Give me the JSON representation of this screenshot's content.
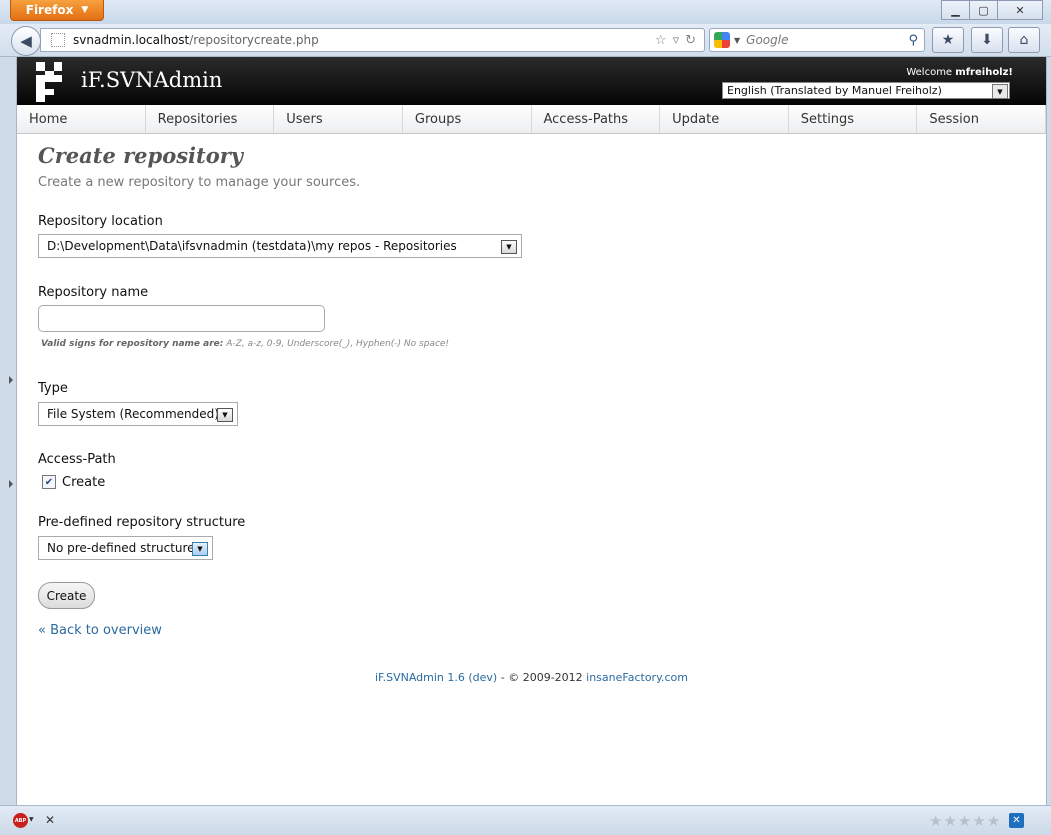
{
  "browser": {
    "menu_button": "Firefox",
    "url_host": "svnadmin.localhost",
    "url_path": "/repositorycreate.php",
    "search_placeholder": "Google"
  },
  "app": {
    "title": "iF.SVNAdmin",
    "welcome_prefix": "Welcome",
    "username": "mfreiholz!",
    "language": "English (Translated by Manuel Freiholz)"
  },
  "nav": {
    "items": [
      "Home",
      "Repositories",
      "Users",
      "Groups",
      "Access-Paths",
      "Update",
      "Settings",
      "Session"
    ]
  },
  "page": {
    "title": "Create repository",
    "subtitle": "Create a new repository to manage your sources.",
    "location_label": "Repository location",
    "location_value": "D:\\Development\\Data\\ifsvnadmin (testdata)\\my repos - Repositories",
    "name_label": "Repository name",
    "name_value": "",
    "hint_bold": "Valid signs for repository name are:",
    "hint_text": " A-Z, a-z, 0-9, Underscore(_), Hyphen(-) No space!",
    "type_label": "Type",
    "type_value": "File System (Recommended)",
    "access_path_label": "Access-Path",
    "access_path_checkbox": "Create",
    "access_path_checked": true,
    "structure_label": "Pre-defined repository structure",
    "structure_value": "No pre-defined structure",
    "create_button": "Create",
    "back_link": "« Back to overview"
  },
  "footer": {
    "version_link": "iF.SVNAdmin 1.6 (dev)",
    "copyright": " - © 2009-2012 ",
    "vendor_link": "insaneFactory.com"
  },
  "statusbar": {
    "abp_label": "ABP"
  },
  "colors": {
    "header_bg": "#000000",
    "link": "#2a6aa0",
    "firefox_orange": "#e26e12"
  }
}
